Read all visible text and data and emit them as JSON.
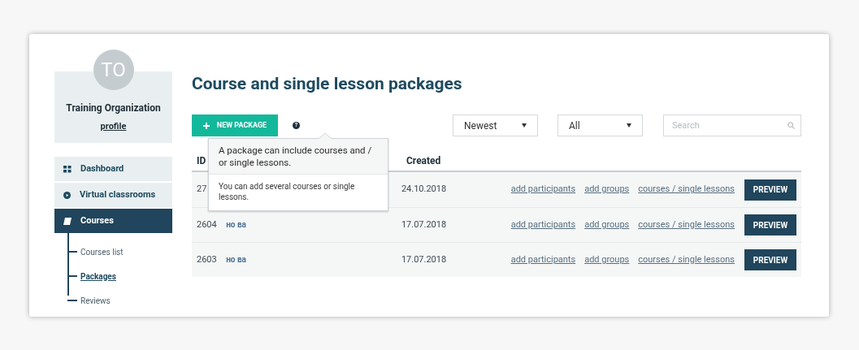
{
  "profile": {
    "initials": "TO",
    "name": "Training Organization",
    "link": "profile"
  },
  "menu": [
    {
      "label": "Dashboard",
      "selected": false
    },
    {
      "label": "Virtual classrooms",
      "selected": false
    },
    {
      "label": "Courses",
      "selected": true,
      "children": [
        {
          "label": "Courses list",
          "selected": false
        },
        {
          "label": "Packages",
          "selected": true
        },
        {
          "label": "Reviews",
          "selected": false
        }
      ]
    }
  ],
  "title": "Course and single lesson packages",
  "new_button": "NEW PACKAGE",
  "help_icon": "?",
  "sort_select": "Newest",
  "filter_select": "All",
  "search": {
    "placeholder": "Search"
  },
  "tooltip": {
    "heading": "A package can include courses and / or single lessons.",
    "body": "You can add several courses or single lessons."
  },
  "table": {
    "columns": [
      "ID",
      "Created"
    ],
    "rows": [
      {
        "id": "27",
        "created": "24.10.2018",
        "links": [
          "add participants",
          "add groups",
          "courses / single lessons"
        ],
        "button": "PREVIEW"
      },
      {
        "id": "2604",
        "name": "но ва",
        "created": "17.07.2018",
        "links": [
          "add participants",
          "add groups",
          "courses / single lessons"
        ],
        "button": "PREVIEW"
      },
      {
        "id": "2603",
        "name": "но ва",
        "created": "17.07.2018",
        "links": [
          "add participants",
          "add groups",
          "courses / single lessons"
        ],
        "button": "PREVIEW"
      }
    ]
  }
}
